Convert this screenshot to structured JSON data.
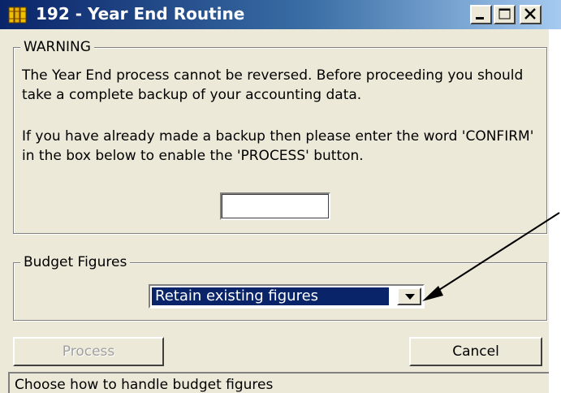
{
  "window": {
    "title": "192 - Year End Routine",
    "icon": "ledger-books-icon"
  },
  "title_buttons": {
    "minimize": "minimize-icon",
    "maximize": "maximize-icon",
    "close": "close-icon"
  },
  "warning": {
    "legend": "WARNING",
    "text1": "The Year End process cannot be reversed. Before proceeding you should take a complete backup of your accounting data.",
    "text2": "If you have already made a backup then please enter the word 'CONFIRM' in the box below to enable the 'PROCESS' button.",
    "confirm_value": ""
  },
  "budget": {
    "legend": "Budget Figures",
    "selected": "Retain existing figures",
    "dropdown_icon": "chevron-down-icon"
  },
  "buttons": {
    "process": "Process",
    "cancel": "Cancel"
  },
  "status": {
    "text": "Choose how to handle budget figures"
  },
  "colors": {
    "titlebar_start": "#0a246a",
    "titlebar_end": "#a6caf0",
    "face": "#ece9d8",
    "selection": "#0a246a"
  }
}
